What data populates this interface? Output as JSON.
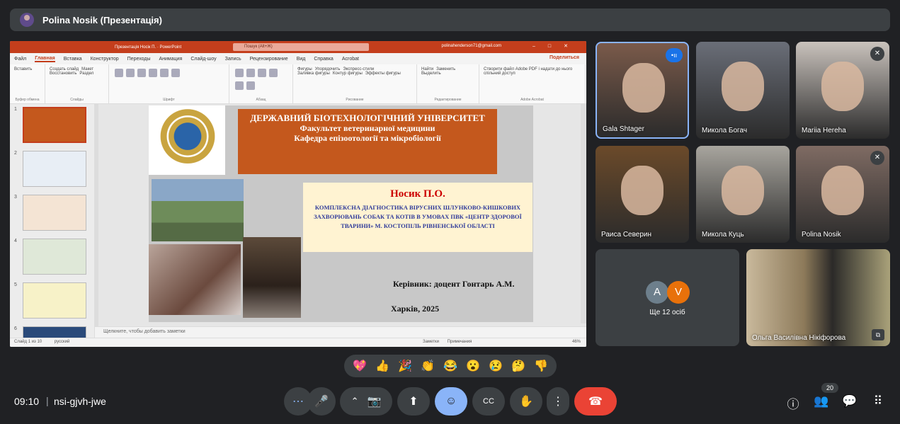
{
  "presenter": {
    "label": "Polina Nosik (Презентація)"
  },
  "powerpoint": {
    "window_title": "Презентація Носік П. · PowerPoint",
    "search_placeholder": "Пошук (Alt+Ж)",
    "account_email": "polinahenderson71@gmail.com",
    "menu": [
      "Файл",
      "Главная",
      "Вставка",
      "Конструктор",
      "Переходы",
      "Анимация",
      "Слайд-шоу",
      "Запись",
      "Рецензирование",
      "Вид",
      "Справка",
      "Acrobat"
    ],
    "active_menu": "Главная",
    "share_label": "Поделиться",
    "ribbon_groups": [
      {
        "label": "Буфер обмена",
        "buttons": [
          "Вставить"
        ]
      },
      {
        "label": "Слайды",
        "buttons": [
          "Создать слайд",
          "Макет",
          "Восстановить",
          "Раздел"
        ]
      },
      {
        "label": "Шрифт",
        "buttons": []
      },
      {
        "label": "Абзац",
        "buttons": []
      },
      {
        "label": "Рисование",
        "buttons": [
          "Фигуры",
          "Упорядочить",
          "Экспресс-стили",
          "Заливка фигуры",
          "Контур фигуры",
          "Эффекты фигуры"
        ]
      },
      {
        "label": "Редактирование",
        "buttons": [
          "Найти",
          "Заменить",
          "Выделить"
        ]
      },
      {
        "label": "Adobe Acrobat",
        "buttons": [
          "Створити файл Adobe PDF і надати до нього спільний доступ"
        ]
      }
    ],
    "thumbnail_numbers": [
      "1",
      "2",
      "3",
      "4",
      "5",
      "6"
    ],
    "notes_placeholder": "Щелкните, чтобы добавить заметки",
    "status_left": "Слайд 1 из 10",
    "status_lang": "русский",
    "status_notes": "Заметки",
    "status_comments": "Примечания",
    "zoom": "46%"
  },
  "slide": {
    "university": "ДЕРЖАВНИЙ БІОТЕХНОЛОГІЧНИЙ УНІВЕРСИТЕТ",
    "faculty": "Факультет ветеринарної медицини",
    "department": "Кафедра епізоотології та мікробіології",
    "author": "Носик П.О.",
    "topic": "КОМПЛЕКСНА ДІАГНОСТИКА ВІРУСНИХ ШЛУНКОВО-КИШКОВИХ ЗАХВОРЮВАНЬ СОБАК ТА КОТІВ В УМОВАХ ПВК «ЦЕНТР ЗДОРОВОЇ ТВАРИНИ» М. КОСТОПІЛЬ РІВНЕНСЬКОЇ ОБЛАСТІ",
    "supervisor": "Керівник: доцент Гонтарь А.М.",
    "city_year": "Харків,  2025"
  },
  "participants": [
    {
      "name": "Gala Shtager",
      "bg": "#7a5a4a"
    },
    {
      "name": "Микола Богач",
      "bg": "#6a6e78"
    },
    {
      "name": "Mariia Hereha",
      "bg": "#c9c2bc"
    },
    {
      "name": "Раиса Северин",
      "bg": "#6b4a2a"
    },
    {
      "name": "Микола Куць",
      "bg": "#a8a59e"
    },
    {
      "name": "Polina Nosik",
      "bg": "#7f6b63"
    }
  ],
  "others": {
    "initials": [
      "A",
      "V"
    ],
    "label": "Ще 12 осіб",
    "colors": [
      "#6d7f8c",
      "#e8710a"
    ]
  },
  "host_tile": {
    "name": "Ольга Василівна Нікіфорова"
  },
  "reactions": [
    "💖",
    "👍",
    "🎉",
    "👏",
    "😂",
    "😮",
    "😢",
    "🤔",
    "👎"
  ],
  "bottom": {
    "time": "09:10",
    "separator": "|",
    "meeting_code": "nsi-gjvh-jwe",
    "participants_count": "20"
  },
  "icons": {
    "more": "⋯",
    "mic": "🎤",
    "chevron_up": "⌃",
    "camera": "📷",
    "present": "⬆",
    "emoji": "☺",
    "captions": "CC",
    "hand": "✋",
    "kebab": "⋮",
    "hangup": "☎",
    "info": "ⓘ",
    "people": "👥",
    "chat": "💬",
    "apps": "⠿",
    "mic_off": "✕",
    "speaking": "•ıı",
    "pip": "⧉"
  }
}
